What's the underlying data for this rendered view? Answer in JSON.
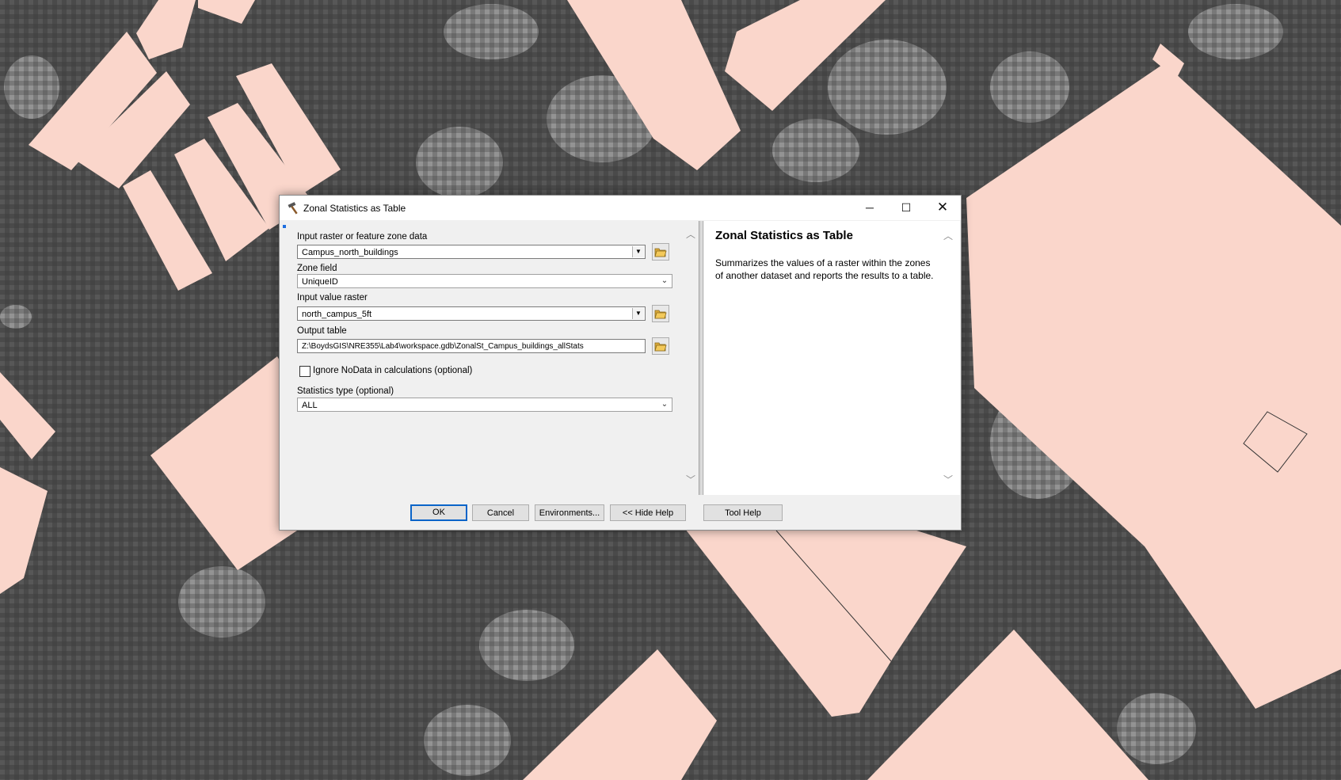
{
  "map_colors": {
    "background": "#4a4a4a",
    "building_fill": "#fad6cb",
    "tree_light": "#8c8c8c"
  },
  "dialog": {
    "title": "Zonal Statistics as Table",
    "title_icon": "hammer-icon",
    "window_controls": {
      "minimize": "─",
      "maximize": "☐",
      "close": "✕"
    },
    "params": {
      "input_zone_label": "Input raster or feature zone data",
      "input_zone_value": "Campus_north_buildings",
      "zone_field_label": "Zone field",
      "zone_field_value": "UniqueID",
      "value_raster_label": "Input value raster",
      "value_raster_value": "north_campus_5ft",
      "output_table_label": "Output table",
      "output_table_value": "Z:\\BoydsGIS\\NRE355\\Lab4\\workspace.gdb\\ZonalSt_Campus_buildings_allStats",
      "ignore_nodata_label": "Ignore NoData in calculations (optional)",
      "ignore_nodata_checked": false,
      "stats_type_label": "Statistics type (optional)",
      "stats_type_value": "ALL"
    },
    "help": {
      "title": "Zonal Statistics as Table",
      "body": "Summarizes the values of a raster within the zones of another dataset and reports the results to a table."
    },
    "buttons": {
      "ok": "OK",
      "cancel": "Cancel",
      "environments": "Environments...",
      "hide_help": "<< Hide Help",
      "tool_help": "Tool Help"
    }
  }
}
